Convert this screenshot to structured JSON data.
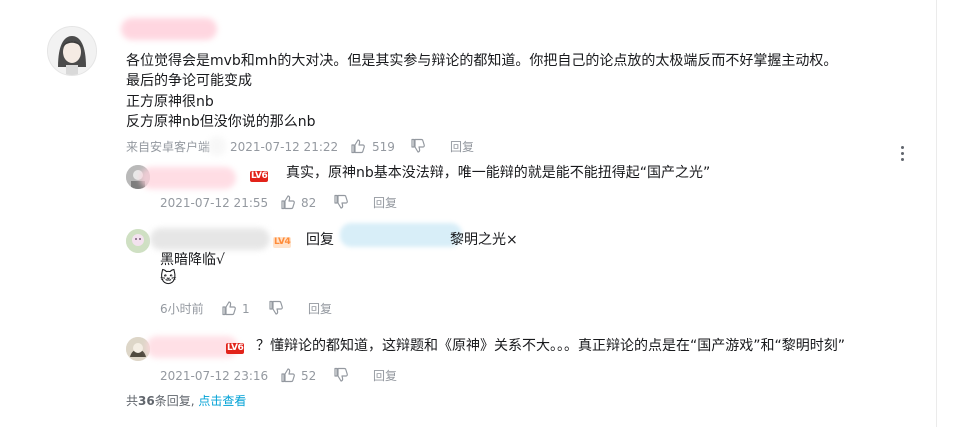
{
  "main_comment": {
    "text_lines": [
      "各位觉得会是mvb和mh的大对决。但是其实参与辩论的都知道。你把自己的论点放的太极端反而不好掌握主动权。",
      "最后的争论可能变成",
      "正方原神很nb",
      "反方原神nb但没你说的那么nb"
    ],
    "source": "来自安卓客户端",
    "timestamp": "2021-07-12 21:22",
    "likes": "519",
    "reply_label": "回复"
  },
  "replies": [
    {
      "level": "LV6",
      "text": "真实，原神nb基本没法辩，唯一能辩的就是能不能扭得起“国产之光”",
      "timestamp": "2021-07-12 21:55",
      "likes": "82",
      "reply_label": "回复"
    },
    {
      "level": "LV4",
      "reply_prefix": "回复",
      "mention_suffix": "黎明之光×",
      "line2": "黑暗降临√",
      "emoji": "🐱",
      "timestamp": "6小时前",
      "likes": "1",
      "reply_label": "回复"
    },
    {
      "level": "LV6",
      "text": "？懂辩论的都知道，这辩题和《原神》关系不大。。。真正辩论的点是在“国产游戏”和“黎明时刻”",
      "timestamp": "2021-07-12 23:16",
      "likes": "52",
      "reply_label": "回复"
    }
  ],
  "footer": {
    "prefix": "共",
    "count": "36",
    "suffix": "条回复,",
    "view_link": "点击查看"
  },
  "colors": {
    "link": "#00a1d6",
    "level_red": "#e2231a",
    "level_orange": "#ffe3cc",
    "meta_gray": "#9499a0"
  },
  "icons": [
    "thumbs-up-icon",
    "thumbs-down-icon",
    "more-vertical-icon",
    "avatar"
  ]
}
